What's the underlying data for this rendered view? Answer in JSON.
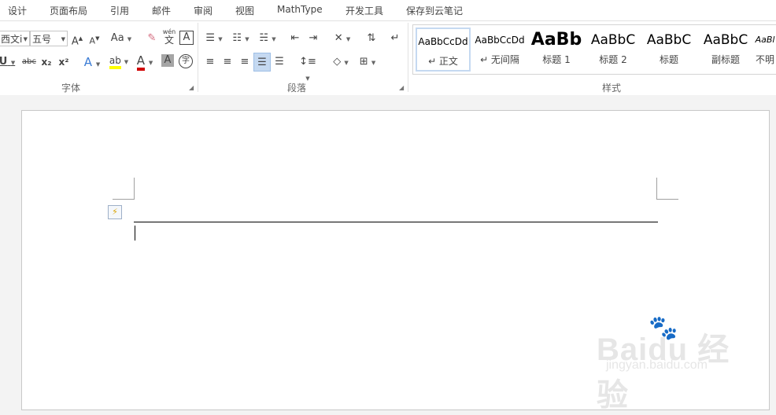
{
  "tabs": [
    "设计",
    "页面布局",
    "引用",
    "邮件",
    "审阅",
    "视图",
    "MathType",
    "开发工具",
    "保存到云笔记"
  ],
  "font_group": {
    "font_name": "西文i",
    "font_size": "五号",
    "grow_font": "A",
    "shrink_font": "A",
    "change_case": "Aa",
    "phonetic_top": "wén",
    "phonetic_bottom": "文",
    "char_border": "A",
    "underline": "U",
    "strike": "abc",
    "subscript": "x₂",
    "superscript": "x²",
    "text_effect": "A",
    "highlight": "ab",
    "font_color": "A",
    "char_shading": "A",
    "enclose": "字",
    "label": "字体"
  },
  "paragraph_group": {
    "label": "段落"
  },
  "styles_group": {
    "label": "样式",
    "items": [
      {
        "preview": "AaBbCcDd",
        "name": "↵ 正文"
      },
      {
        "preview": "AaBbCcDd",
        "name": "↵ 无间隔"
      },
      {
        "preview": "AaBb",
        "name": "标题 1"
      },
      {
        "preview": "AaBbC",
        "name": "标题 2"
      },
      {
        "preview": "AaBbC",
        "name": "标题"
      },
      {
        "preview": "AaBbC",
        "name": "副标题"
      },
      {
        "preview": "AaBl",
        "name": "不明"
      }
    ]
  },
  "watermark": {
    "main": "Baidu 经验",
    "sub": "jingyan.baidu.com"
  },
  "colors": {
    "highlight": "#ffff00",
    "font_color": "#d00000",
    "selected_style_border": "#c5d9f1"
  }
}
